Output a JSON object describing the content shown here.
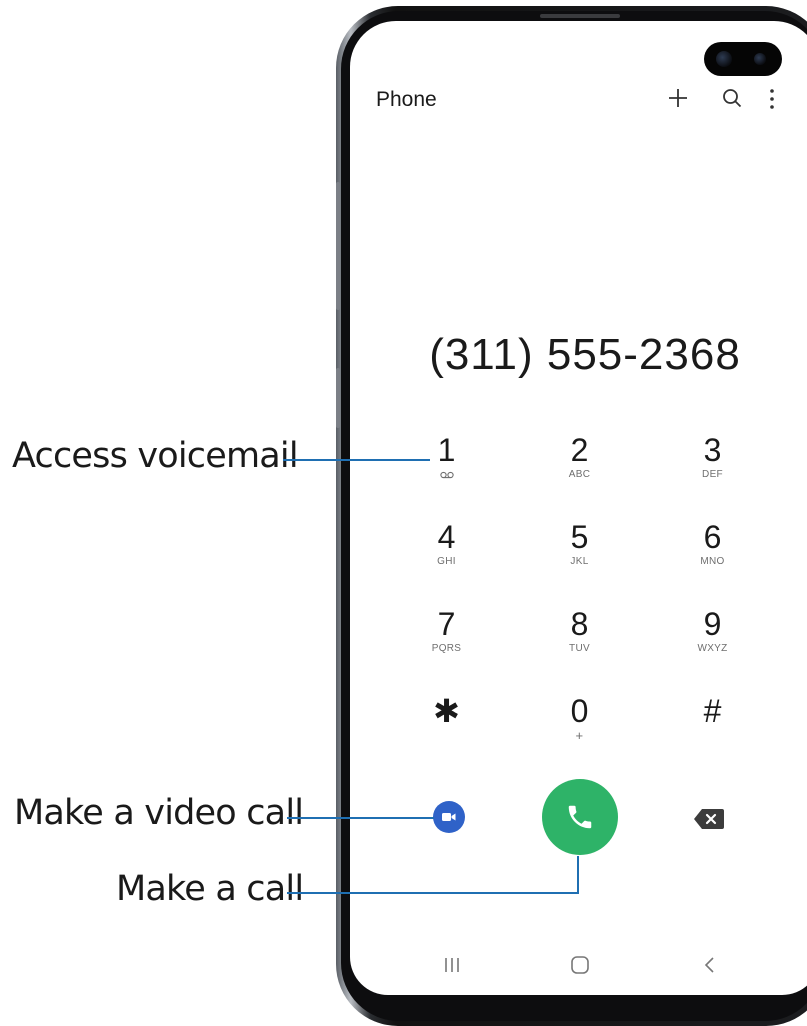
{
  "app": {
    "title": "Phone"
  },
  "header_icons": [
    "add-icon",
    "search-icon",
    "more-options-icon"
  ],
  "dialed_number": "(311) 555-2368",
  "keypad": [
    {
      "digit": "1",
      "letters": "",
      "icon": "voicemail-icon"
    },
    {
      "digit": "2",
      "letters": "ABC"
    },
    {
      "digit": "3",
      "letters": "DEF"
    },
    {
      "digit": "4",
      "letters": "GHI"
    },
    {
      "digit": "5",
      "letters": "JKL"
    },
    {
      "digit": "6",
      "letters": "MNO"
    },
    {
      "digit": "7",
      "letters": "PQRS"
    },
    {
      "digit": "8",
      "letters": "TUV"
    },
    {
      "digit": "9",
      "letters": "WXYZ"
    },
    {
      "digit": "✱",
      "letters": ""
    },
    {
      "digit": "0",
      "letters": "+"
    },
    {
      "digit": "#",
      "letters": ""
    }
  ],
  "actions": {
    "video_call_icon": "video-call-icon",
    "call_icon": "phone-call-icon",
    "backspace_icon": "backspace-icon"
  },
  "nav": [
    "recent-apps-icon",
    "home-icon",
    "back-icon"
  ],
  "callouts": {
    "voicemail": "Access voicemail",
    "video_call": "Make a video call",
    "call": "Make a call"
  },
  "colors": {
    "call_green": "#2eb368",
    "video_blue": "#2f62c8",
    "callout_line": "#1f6fb2"
  }
}
